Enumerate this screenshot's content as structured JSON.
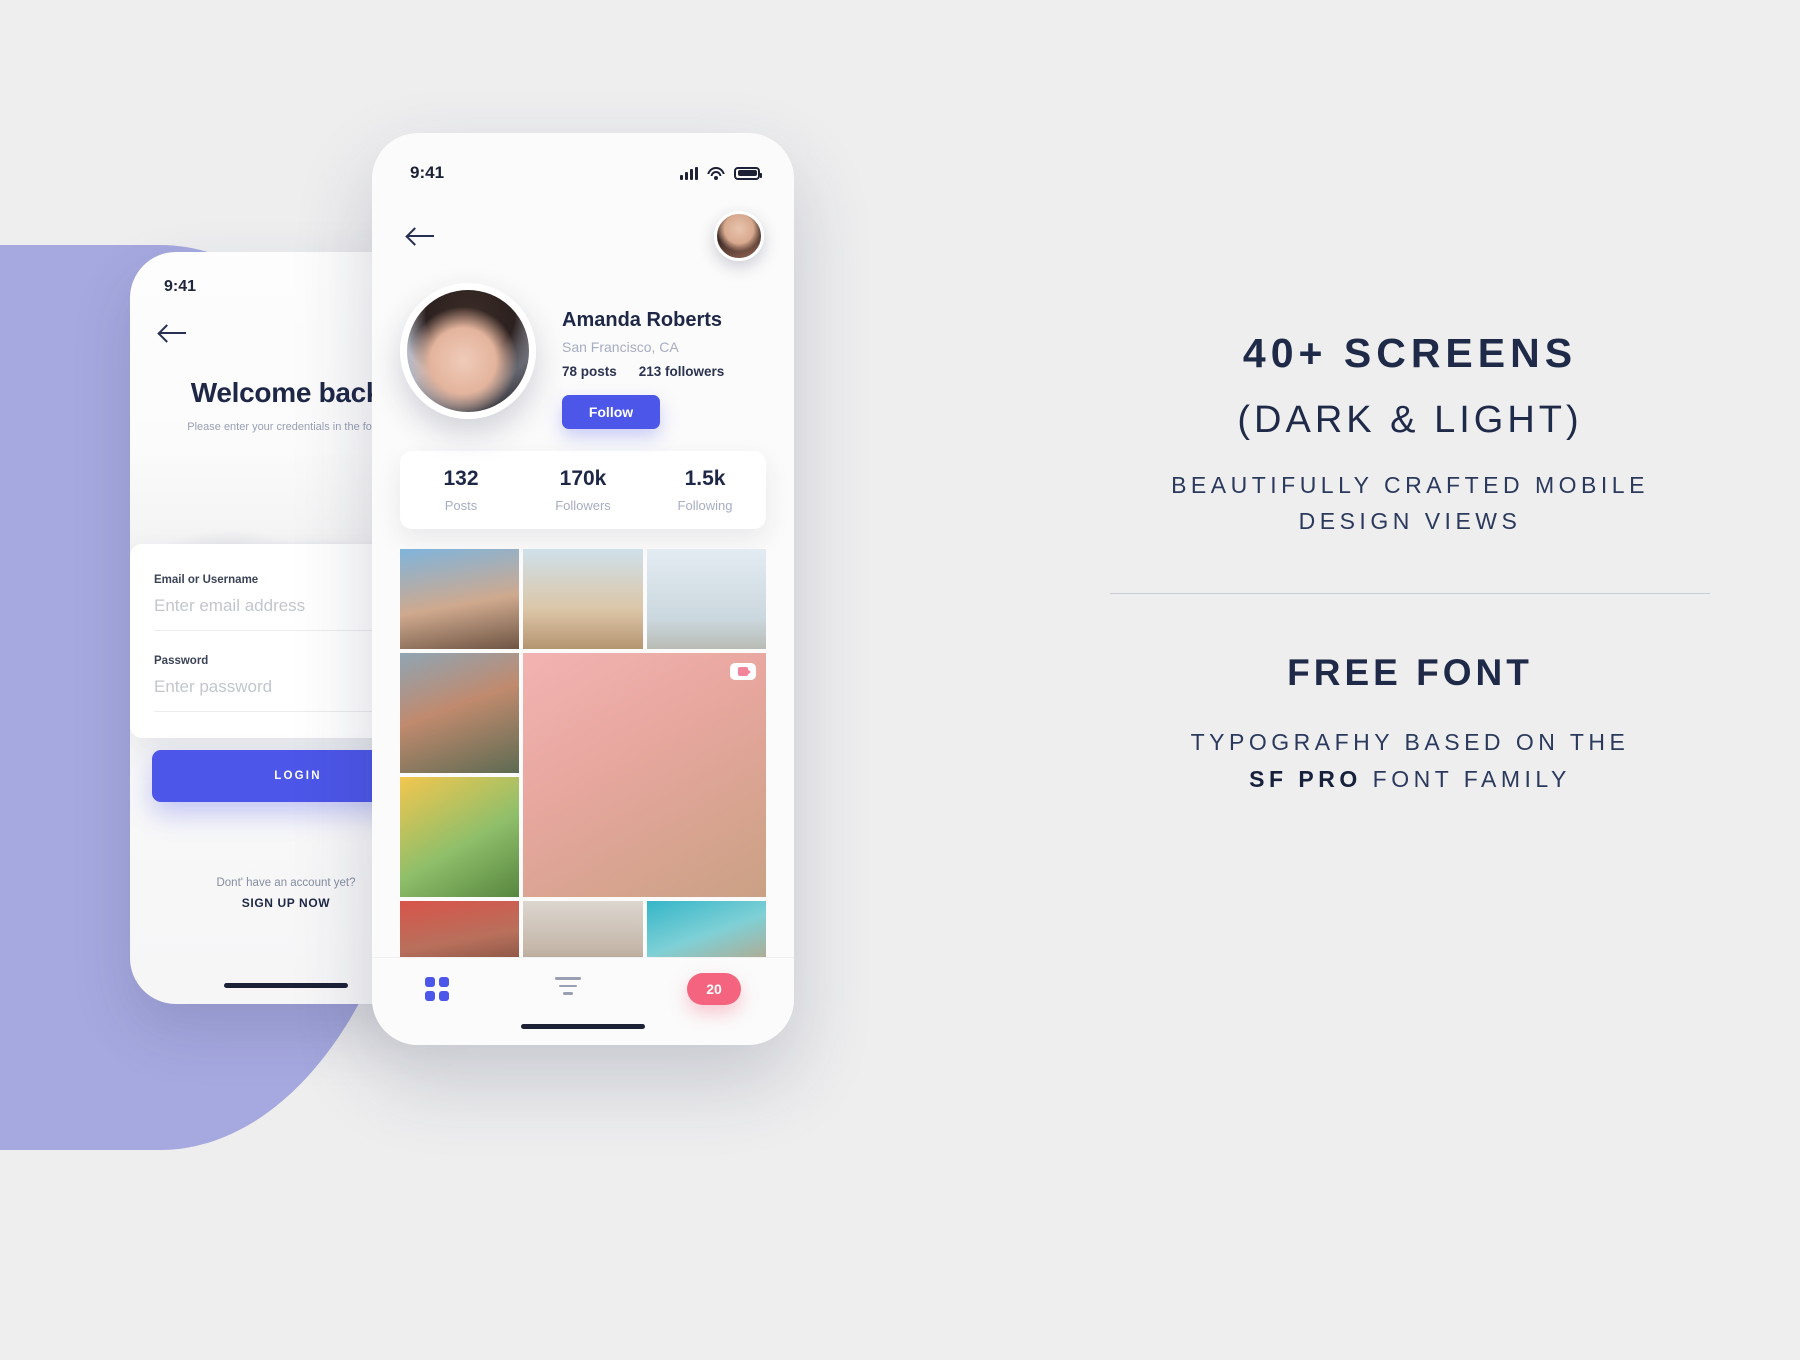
{
  "login_screen": {
    "status_time": "9:41",
    "back_icon": "arrow-left-icon",
    "title": "Welcome back",
    "subtitle": "Please enter your credentials in the form",
    "fields": [
      {
        "label": "Email or Username",
        "placeholder": "Enter email address",
        "value": ""
      },
      {
        "label": "Password",
        "placeholder": "Enter password",
        "value": ""
      }
    ],
    "login_button": "LOGIN",
    "signup_question": "Dont' have an account yet?",
    "signup_action": "SIGN UP NOW"
  },
  "profile_screen": {
    "status_time": "9:41",
    "back_icon": "arrow-left-icon",
    "avatar_icon": "user-avatar",
    "name": "Amanda Roberts",
    "location": "San Francisco, CA",
    "meta_posts": "78 posts",
    "meta_followers": "213 followers",
    "follow_button": "Follow",
    "stats": [
      {
        "value": "132",
        "label": "Posts"
      },
      {
        "value": "170k",
        "label": "Followers"
      },
      {
        "value": "1.5k",
        "label": "Following"
      }
    ],
    "video_badge_icon": "video-camera-icon",
    "tabbar": {
      "grid_icon": "grid-view-icon",
      "filter_icon": "filter-lines-icon",
      "badge_count": "20"
    }
  },
  "panel": {
    "headline": "40+ SCREENS",
    "subhead": "(DARK & LIGHT)",
    "description_line1": "BEAUTIFULLY CRAFTED MOBILE",
    "description_line2": "DESIGN VIEWS",
    "font_headline": "FREE FONT",
    "font_line1": "TYPOGRAFHY BASED ON THE",
    "font_line2_bold": "SF PRO",
    "font_line2_rest": "FONT FAMILY"
  },
  "colors": {
    "background": "#eeeeef",
    "accent_blue": "#4c56e8",
    "accent_purple": "#9fa3dd",
    "badge_pink": "#f4647f",
    "navy_text": "#1e2a47"
  }
}
